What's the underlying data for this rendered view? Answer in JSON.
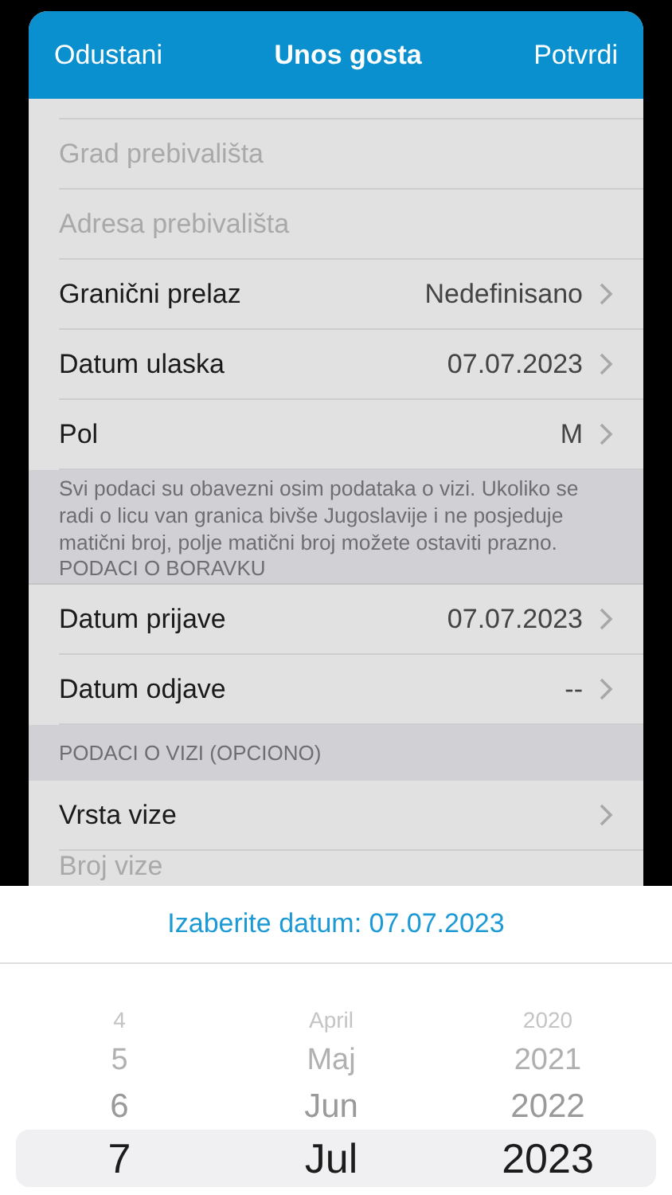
{
  "header": {
    "cancel": "Odustani",
    "title": "Unos gosta",
    "confirm": "Potvrdi"
  },
  "rows": [
    {
      "kind": "placeholder",
      "label": "Grad prebivališta"
    },
    {
      "kind": "placeholder",
      "label": "Adresa prebivališta"
    },
    {
      "kind": "value",
      "label": "Granični prelaz",
      "value": "Nedefinisano"
    },
    {
      "kind": "value",
      "label": "Datum ulaska",
      "value": "07.07.2023"
    },
    {
      "kind": "value",
      "label": "Pol",
      "value": "M"
    },
    {
      "kind": "note",
      "text": "Svi podaci su obavezni osim podataka o vizi. Ukoliko se radi o licu van granica bivše Jugoslavije i ne posjeduje matični broj, polje matični broj možete ostaviti prazno.",
      "header": "PODACI O BORAVKU"
    },
    {
      "kind": "value",
      "label": "Datum prijave",
      "value": "07.07.2023"
    },
    {
      "kind": "value",
      "label": "Datum odjave",
      "value": "--"
    },
    {
      "kind": "section",
      "header": "PODACI O VIZI (OPCIONO)"
    },
    {
      "kind": "value",
      "label": "Vrsta vize"
    },
    {
      "kind": "placeholder",
      "label": "Broj vize"
    }
  ],
  "picker": {
    "title": "Izaberite datum: 07.07.2023",
    "rows": [
      {
        "day": "4",
        "month": "April",
        "year": "2020",
        "selected": false
      },
      {
        "day": "5",
        "month": "Maj",
        "year": "2021",
        "selected": false
      },
      {
        "day": "6",
        "month": "Jun",
        "year": "2022",
        "selected": false
      },
      {
        "day": "7",
        "month": "Jul",
        "year": "2023",
        "selected": true
      }
    ]
  }
}
